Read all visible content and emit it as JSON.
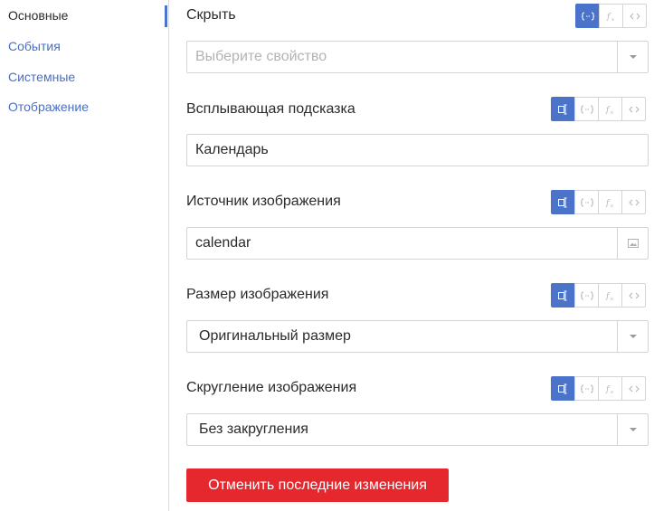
{
  "sidebar": {
    "items": [
      {
        "label": "Основные"
      },
      {
        "label": "События"
      },
      {
        "label": "Системные"
      },
      {
        "label": "Отображение"
      }
    ]
  },
  "mode_icons": {
    "static": "bind-static-icon",
    "data": "data-binding-icon",
    "formula": "formula-fx-icon",
    "code": "code-brackets-icon"
  },
  "fields": {
    "hide": {
      "label": "Скрыть",
      "placeholder": "Выберите свойство",
      "value": "",
      "active_mode": "data"
    },
    "tooltip": {
      "label": "Всплывающая подсказка",
      "value": "Календарь",
      "active_mode": "static"
    },
    "image_source": {
      "label": "Источник изображения",
      "value": "calendar",
      "active_mode": "static"
    },
    "image_size": {
      "label": "Размер изображения",
      "value": "Оригинальный размер",
      "active_mode": "static"
    },
    "image_rounding": {
      "label": "Скругление изображения",
      "value": "Без закругления",
      "active_mode": "static"
    }
  },
  "actions": {
    "undo_label": "Отменить последние изменения"
  },
  "colors": {
    "accent": "#4a73c9",
    "danger": "#e5282e",
    "link": "#4a6fc4"
  }
}
